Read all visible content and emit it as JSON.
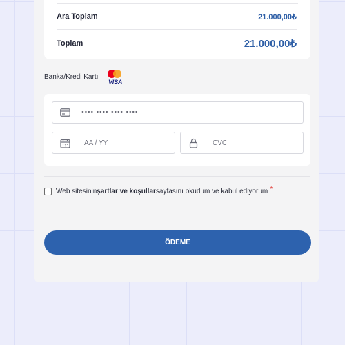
{
  "summary": {
    "subtotal_label": "Ara Toplam",
    "subtotal_value": "21.000,00₺",
    "total_label": "Toplam",
    "total_value": "21.000,00₺"
  },
  "payment": {
    "title": "Banka/Kredi Kartı",
    "logos": [
      "mastercard-logo",
      "visa-logo"
    ],
    "visa_text": "VISA",
    "card_number_placeholder": "•••• •••• •••• ••••",
    "expiry_placeholder": "AA / YY",
    "cvc_placeholder": "CVC"
  },
  "terms": {
    "prefix": "Web sitesinin ",
    "link": "şartlar ve koşullar",
    "suffix": " sayfasını okudum ve kabul ediyorum",
    "required_mark": "*"
  },
  "pay_button_label": "ÖDEME",
  "colors": {
    "accent": "#2d62ae",
    "price": "#2d5ea6",
    "required": "#e0342f",
    "mastercard_red": "#eb001b",
    "mastercard_orange": "#f79e1b",
    "visa_blue": "#1a237e"
  }
}
